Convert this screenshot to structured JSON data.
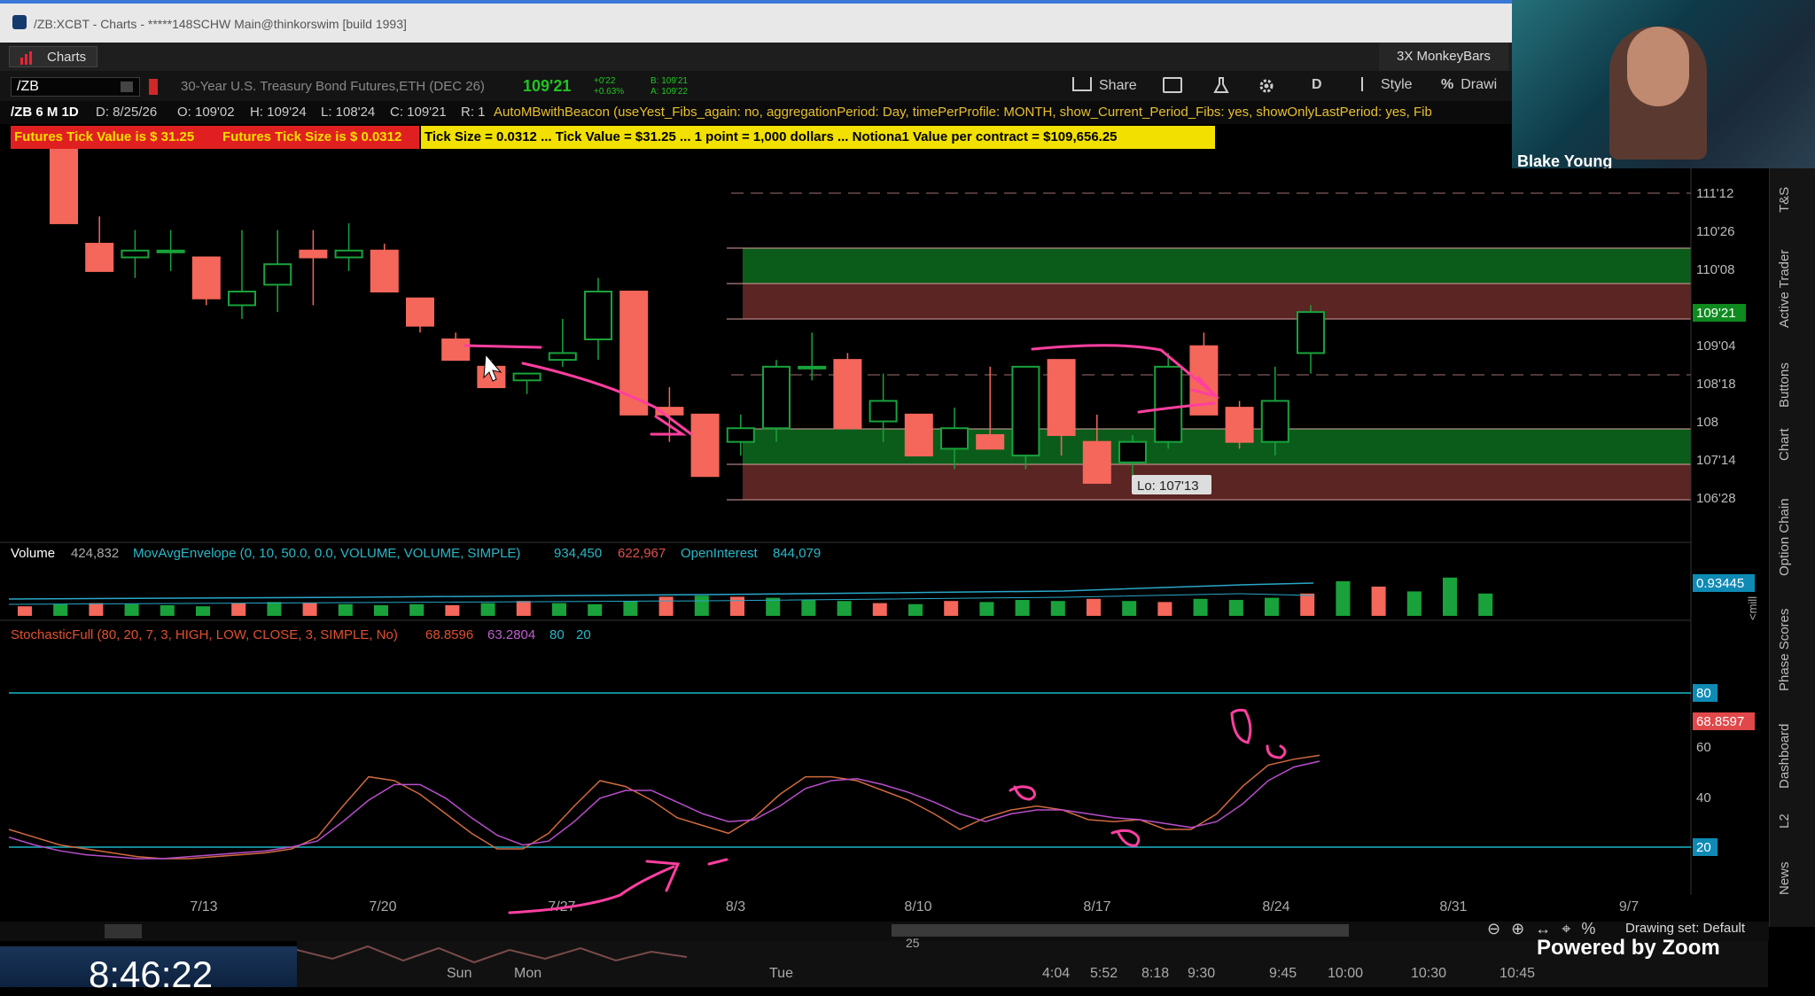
{
  "window": {
    "title": "/ZB:XCBT - Charts - *****148SCHW Main@thinkorswim [build 1993]"
  },
  "tabs": {
    "charts_label": "Charts",
    "layout_name": "3X MonkeyBars"
  },
  "symbol": {
    "ticker": "/ZB",
    "description": "30-Year U.S. Treasury Bond Futures,ETH (DEC 26)",
    "last": "109'21",
    "change": "+0'22",
    "change_pct": "+0.63%",
    "bid": "B: 109'21",
    "ask": "A: 109'22"
  },
  "toolbar": {
    "share": "Share",
    "period": "D",
    "style": "Style",
    "drawings": "Drawi"
  },
  "info": {
    "label": "/ZB 6 M 1D",
    "date": "D: 8/25/26",
    "open": "O: 109'02",
    "high": "H: 109'24",
    "low": "L: 108'24",
    "close": "C: 109'21",
    "range": "R: 1",
    "study": "AutoMBwithBeacon (useYest_Fibs_again: no, aggregationPeriod: Day, timePerProfile: MONTH, show_Current_Period_Fibs: yes, showOnlyLastPeriod: yes, Fib"
  },
  "labels": {
    "tick_value": "Futures Tick Value is $ 31.25",
    "tick_size": "Futures Tick Size is $ 0.0312",
    "summary": "Tick Size =  0.0312 ... Tick Value =  $31.25 ... 1 point = 1,000 dollars ... Notiona1 Value per contract =  $109,656.25"
  },
  "price_axis": {
    "ticks": [
      "111'12",
      "110'26",
      "110'08",
      "109'04",
      "108'18",
      "108",
      "107'14",
      "106'28"
    ],
    "current": "109'21",
    "lo_label": "Lo: 107'13"
  },
  "volume_panel": {
    "label": "Volume",
    "value": "424,832",
    "study": "MovAvgEnvelope (0, 10, 50.0, 0.0, VOLUME, VOLUME, SIMPLE)",
    "upper": "934,450",
    "lower": "622,967",
    "oi_label": "OpenInterest",
    "oi_value": "844,079",
    "axis_value": "0.93445",
    "axis_unit": "<mill",
    "volumes": [
      0.18,
      0.22,
      0.24,
      0.22,
      0.2,
      0.18,
      0.24,
      0.26,
      0.24,
      0.22,
      0.2,
      0.22,
      0.2,
      0.24,
      0.28,
      0.24,
      0.22,
      0.28,
      0.36,
      0.38,
      0.36,
      0.34,
      0.3,
      0.28,
      0.24,
      0.22,
      0.28,
      0.26,
      0.3,
      0.28,
      0.32,
      0.28,
      0.26,
      0.32,
      0.3,
      0.34,
      0.42,
      0.65,
      0.55,
      0.46,
      0.72,
      0.42
    ]
  },
  "stoch_panel": {
    "label": "StochasticFull (80, 20, 7, 3, HIGH, LOW, CLOSE, 3, SIMPLE, No)",
    "k": "68.8596",
    "d": "63.2804",
    "ob": "80",
    "os": "20",
    "axis_ticks": [
      "60",
      "40"
    ],
    "axis_k": "68.8597",
    "axis_ob": "80",
    "axis_os": "20"
  },
  "x_axis": {
    "labels": [
      "7/13",
      "7/20",
      "7/27",
      "8/3",
      "8/10",
      "8/17",
      "8/24",
      "8/31",
      "9/7"
    ]
  },
  "side_tabs": [
    "T&S",
    "Active Trader",
    "Buttons",
    "Chart",
    "Option Chain",
    "Phase Scores",
    "Dashboard",
    "L2",
    "News"
  ],
  "webcam": {
    "name": "Blake Young"
  },
  "clock": "8:46:22",
  "timeline": {
    "labels": [
      "Sun",
      "Mon",
      "Tue",
      "4:04",
      "5:52",
      "8:18",
      "9:30",
      "9:45",
      "10:00",
      "10:30",
      "10:45"
    ],
    "badge": "25"
  },
  "footer": {
    "drawing_set": "Drawing set: Default",
    "zoom_text": "Powered by Zoom"
  },
  "colors": {
    "up": "#19a23b",
    "down": "#f4675a",
    "k_line": "#d06a3e",
    "d_line": "#b84ecb",
    "annotation": "#ff3fa0"
  },
  "chart_data": {
    "type": "candlestick",
    "candles": [
      {
        "o": 112.8,
        "h": 113.2,
        "l": 111.0,
        "c": 111.0
      },
      {
        "o": 110.7,
        "h": 111.1,
        "l": 110.3,
        "c": 110.3
      },
      {
        "o": 110.5,
        "h": 110.9,
        "l": 110.2,
        "c": 110.6
      },
      {
        "o": 110.6,
        "h": 110.9,
        "l": 110.3,
        "c": 110.6
      },
      {
        "o": 110.5,
        "h": 110.5,
        "l": 109.8,
        "c": 109.9
      },
      {
        "o": 109.8,
        "h": 110.9,
        "l": 109.6,
        "c": 110.0
      },
      {
        "o": 110.1,
        "h": 110.9,
        "l": 109.7,
        "c": 110.4
      },
      {
        "o": 110.6,
        "h": 110.9,
        "l": 109.8,
        "c": 110.5
      },
      {
        "o": 110.5,
        "h": 111.0,
        "l": 110.3,
        "c": 110.6
      },
      {
        "o": 110.6,
        "h": 110.7,
        "l": 110.0,
        "c": 110.0
      },
      {
        "o": 109.9,
        "h": 109.9,
        "l": 109.4,
        "c": 109.5
      },
      {
        "o": 109.3,
        "h": 109.4,
        "l": 109.0,
        "c": 109.0
      },
      {
        "o": 108.9,
        "h": 109.0,
        "l": 108.6,
        "c": 108.6
      },
      {
        "o": 108.7,
        "h": 108.8,
        "l": 108.5,
        "c": 108.8
      },
      {
        "o": 109.0,
        "h": 109.6,
        "l": 108.9,
        "c": 109.1
      },
      {
        "o": 109.3,
        "h": 110.2,
        "l": 109.0,
        "c": 110.0
      },
      {
        "o": 110.0,
        "h": 110.0,
        "l": 108.2,
        "c": 108.2
      },
      {
        "o": 108.3,
        "h": 108.6,
        "l": 107.8,
        "c": 108.2
      },
      {
        "o": 108.2,
        "h": 108.2,
        "l": 107.3,
        "c": 107.3
      },
      {
        "o": 107.8,
        "h": 108.2,
        "l": 107.6,
        "c": 108.0
      },
      {
        "o": 108.0,
        "h": 109.0,
        "l": 107.8,
        "c": 108.9
      },
      {
        "o": 108.9,
        "h": 109.4,
        "l": 108.7,
        "c": 108.9
      },
      {
        "o": 109.0,
        "h": 109.1,
        "l": 108.0,
        "c": 108.0
      },
      {
        "o": 108.1,
        "h": 108.8,
        "l": 107.8,
        "c": 108.4
      },
      {
        "o": 108.2,
        "h": 108.2,
        "l": 107.6,
        "c": 107.6
      },
      {
        "o": 107.7,
        "h": 108.3,
        "l": 107.4,
        "c": 108.0
      },
      {
        "o": 107.9,
        "h": 108.9,
        "l": 107.7,
        "c": 107.7
      },
      {
        "o": 107.6,
        "h": 108.9,
        "l": 107.4,
        "c": 108.9
      },
      {
        "o": 109.0,
        "h": 109.0,
        "l": 107.6,
        "c": 107.9
      },
      {
        "o": 107.8,
        "h": 108.2,
        "l": 107.2,
        "c": 107.2
      },
      {
        "o": 107.5,
        "h": 107.9,
        "l": 107.2,
        "c": 107.8
      },
      {
        "o": 107.8,
        "h": 109.1,
        "l": 107.7,
        "c": 108.9
      },
      {
        "o": 109.2,
        "h": 109.4,
        "l": 108.2,
        "c": 108.2
      },
      {
        "o": 108.3,
        "h": 108.4,
        "l": 107.7,
        "c": 107.8
      },
      {
        "o": 107.8,
        "h": 108.9,
        "l": 107.6,
        "c": 108.4
      },
      {
        "o": 109.1,
        "h": 109.8,
        "l": 108.8,
        "c": 109.7
      }
    ],
    "stoch_k": [
      30,
      26,
      22,
      20,
      18,
      16,
      15,
      15,
      16,
      17,
      18,
      20,
      26,
      42,
      57,
      55,
      48,
      38,
      28,
      20,
      20,
      28,
      42,
      55,
      52,
      45,
      36,
      32,
      28,
      36,
      48,
      57,
      57,
      55,
      50,
      45,
      38,
      30,
      36,
      40,
      42,
      40,
      35,
      34,
      35,
      30,
      30,
      38,
      52,
      63,
      66,
      68
    ],
    "stoch_d": [
      26,
      22,
      19,
      17,
      16,
      15,
      15,
      16,
      17,
      18,
      19,
      21,
      24,
      34,
      45,
      53,
      53,
      46,
      36,
      27,
      22,
      24,
      34,
      46,
      50,
      50,
      44,
      38,
      34,
      35,
      42,
      51,
      55,
      56,
      53,
      49,
      44,
      38,
      34,
      38,
      40,
      40,
      38,
      36,
      35,
      33,
      31,
      34,
      43,
      55,
      62,
      65
    ]
  }
}
